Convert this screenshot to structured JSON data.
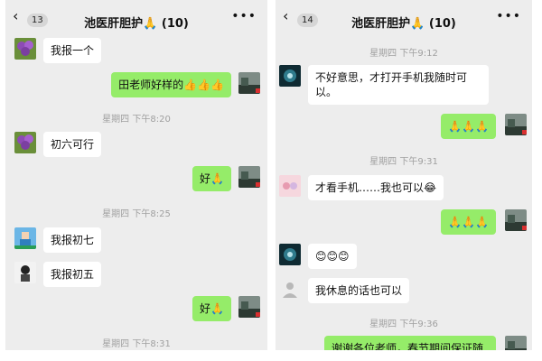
{
  "left": {
    "back_badge": "13",
    "title": "池医肝胆护",
    "title_emoji": "🙏",
    "count": "(10)",
    "messages": [
      {
        "text": "我报一个"
      },
      {
        "text": "田老师好样的",
        "emoji": "👍👍👍"
      },
      {
        "time": "星期四 下午8:20"
      },
      {
        "text": "初六可行"
      },
      {
        "text": "好",
        "emoji": "🙏"
      },
      {
        "time": "星期四 下午8:25"
      },
      {
        "text": "我报初七"
      },
      {
        "text": "我报初五"
      },
      {
        "text": "好",
        "emoji": "🙏"
      },
      {
        "time": "星期四 下午8:31"
      }
    ]
  },
  "right": {
    "back_badge": "14",
    "title": "池医肝胆护",
    "title_emoji": "🙏",
    "count": "(10)",
    "messages": [
      {
        "time": "星期四 下午9:12"
      },
      {
        "text": "不好意思，才打开手机我随时可以。"
      },
      {
        "emoji": "🙏🙏🙏"
      },
      {
        "time": "星期四 下午9:31"
      },
      {
        "text": "才看手机……我也可以",
        "emoji": "😂"
      },
      {
        "emoji": "🙏🙏🙏"
      },
      {
        "emoji": "😊😊😊"
      },
      {
        "text": "我休息的话也可以"
      },
      {
        "time": "星期四 下午9:36"
      },
      {
        "text": "谢谢各位老师，春节期间保证随"
      }
    ]
  },
  "colors": {
    "chat_bg": "#ededed",
    "outgoing_bubble": "#95ec69",
    "incoming_bubble": "#ffffff",
    "timestamp": "#a0a0a0"
  }
}
